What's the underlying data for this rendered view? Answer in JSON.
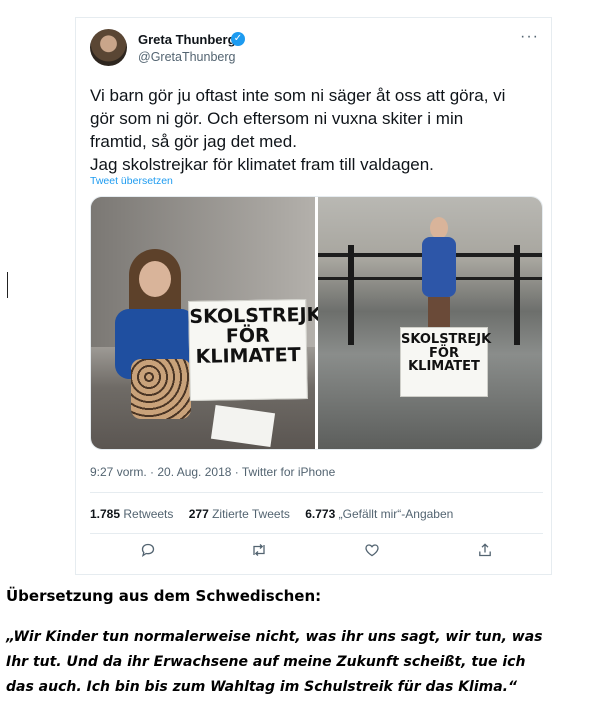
{
  "tweet": {
    "display_name": "Greta Thunberg",
    "handle": "@GretaThunberg",
    "verified_icon": "verified-badge-icon",
    "more_label": "···",
    "text_lines": [
      "Vi barn gör ju oftast inte som ni säger åt oss att göra, vi",
      "gör som ni gör. Och eftersom ni vuxna skiter i min",
      "framtid, så gör jag det med.",
      "Jag skolstrejkar för klimatet fram till valdagen."
    ],
    "translate_link": "Tweet übersetzen",
    "signs": {
      "left": [
        "SKOLSTREJK",
        "FÖR",
        "KLIMATET"
      ],
      "right": [
        "SKOLSTREJK",
        "FÖR",
        "KLIMATET"
      ]
    },
    "timestamp": "9:27 vorm. · 20. Aug. 2018 · Twitter for iPhone",
    "stats": {
      "retweets_count": "1.785",
      "retweets_label": " Retweets",
      "quotes_count": "277",
      "quotes_label": " Zitierte Tweets",
      "likes_count": "6.773",
      "likes_label": " „Gefällt mir“-Angaben"
    },
    "actions": [
      "reply-icon",
      "retweet-icon",
      "like-icon",
      "share-icon"
    ]
  },
  "translation": {
    "heading": "Übersetzung aus dem Schwedischen:",
    "lines": [
      "„Wir Kinder tun normalerweise nicht, was ihr uns sagt, wir tun, was",
      "Ihr tut. Und da ihr Erwachsene auf meine Zukunft scheißt, tue ich",
      "das auch. Ich bin bis zum Wahltag im Schulstreik für das Klima.“"
    ]
  },
  "colors": {
    "accent": "#1d9bf0",
    "secondary_text": "#536471",
    "border": "#e6ecf0"
  }
}
